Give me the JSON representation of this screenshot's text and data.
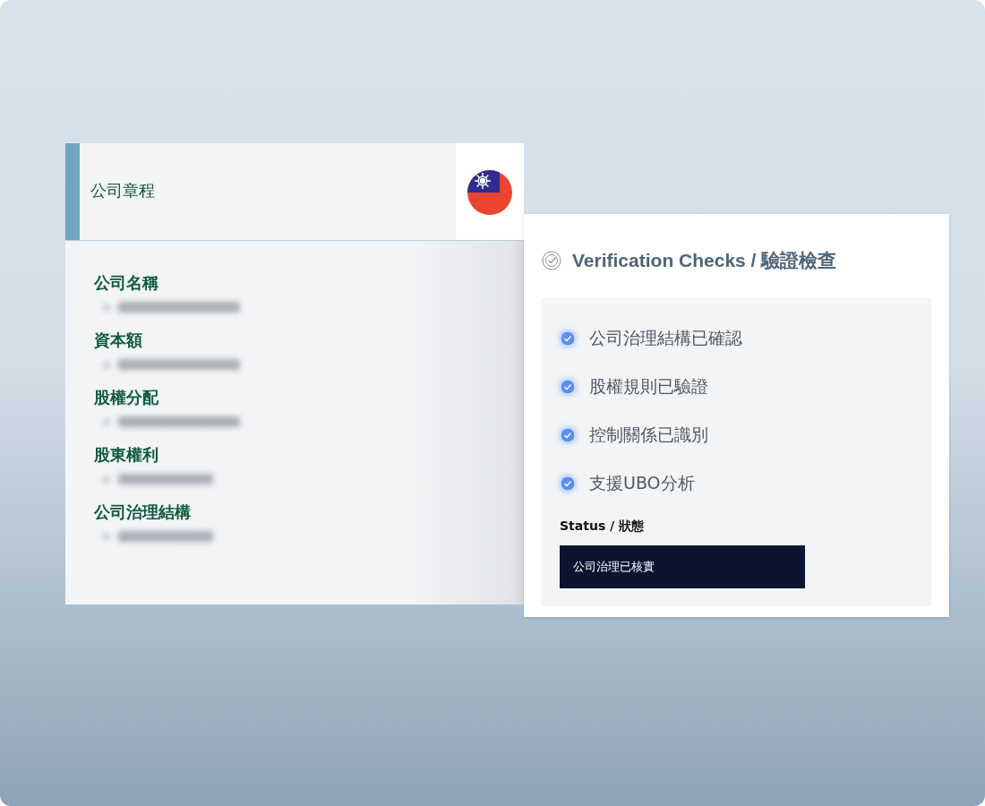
{
  "document_card": {
    "title": "公司章程",
    "fields": [
      {
        "label": "公司名稱"
      },
      {
        "label": "資本額"
      },
      {
        "label": "股權分配"
      },
      {
        "label": "股東權利"
      },
      {
        "label": "公司治理結構"
      }
    ]
  },
  "verification_panel": {
    "title": "Verification Checks / 驗證檢查",
    "checks": [
      {
        "label": "公司治理結構已確認",
        "checked": true
      },
      {
        "label": "股權規則已驗證",
        "checked": true
      },
      {
        "label": "控制關係已識別",
        "checked": true
      },
      {
        "label": "支援UBO分析",
        "checked": true
      }
    ],
    "status_label": "Status / 狀態",
    "status_value": "公司治理已核實"
  }
}
